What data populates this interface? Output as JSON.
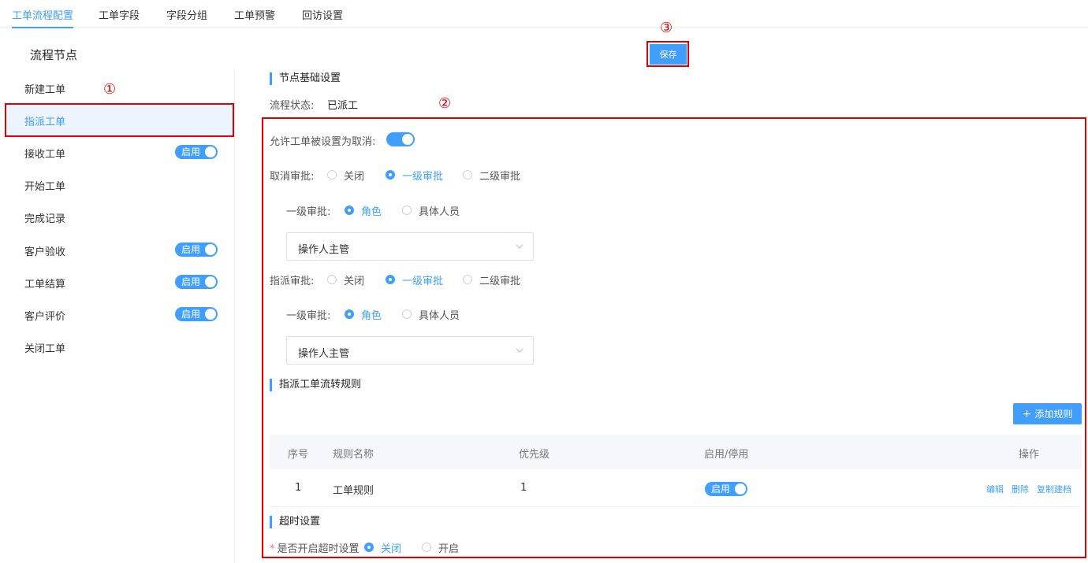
{
  "tabs": [
    {
      "label": "工单流程配置",
      "active": true
    },
    {
      "label": "工单字段",
      "active": false
    },
    {
      "label": "字段分组",
      "active": false
    },
    {
      "label": "工单预警",
      "active": false
    },
    {
      "label": "回访设置",
      "active": false
    }
  ],
  "sidebar": {
    "title": "流程节点",
    "items": [
      {
        "label": "新建工单",
        "toggle": null
      },
      {
        "label": "指派工单",
        "toggle": null
      },
      {
        "label": "接收工单",
        "toggle": "启用"
      },
      {
        "label": "开始工单",
        "toggle": null
      },
      {
        "label": "完成记录",
        "toggle": null
      },
      {
        "label": "客户验收",
        "toggle": "启用"
      },
      {
        "label": "工单结算",
        "toggle": "启用"
      },
      {
        "label": "客户评价",
        "toggle": "启用"
      },
      {
        "label": "关闭工单",
        "toggle": null
      }
    ]
  },
  "annotations": {
    "one": "①",
    "two": "②",
    "three": "③"
  },
  "toolbar": {
    "save_label": "保存"
  },
  "basic": {
    "title": "节点基础设置",
    "status_label": "流程状态:",
    "status_value": "已派工"
  },
  "cancel": {
    "allow_label": "允许工单被设置为取消:",
    "allow_on": true,
    "approval_label": "取消审批:",
    "options": [
      "关闭",
      "一级审批",
      "二级审批"
    ],
    "selected": 1,
    "level1_label": "一级审批:",
    "level1_options": [
      "角色",
      "具体人员"
    ],
    "level1_selected": 0,
    "select_value": "操作人主管"
  },
  "assign": {
    "approval_label": "指派审批:",
    "options": [
      "关闭",
      "一级审批",
      "二级审批"
    ],
    "selected": 1,
    "level1_label": "一级审批:",
    "level1_options": [
      "角色",
      "具体人员"
    ],
    "level1_selected": 0,
    "select_value": "操作人主管"
  },
  "rules": {
    "title": "指派工单流转规则",
    "add_label": "添加规则",
    "columns": [
      "序号",
      "规则名称",
      "优先级",
      "启用/停用",
      "操作"
    ],
    "rows": [
      {
        "index": "1",
        "name": "工单规则",
        "priority": "1",
        "toggle": "启用",
        "actions": [
          "编辑",
          "删除",
          "复制建档"
        ]
      }
    ]
  },
  "timeout": {
    "title": "超时设置",
    "required_mark": "*",
    "label": "是否开启超时设置",
    "options": [
      "关闭",
      "开启"
    ],
    "selected": 0
  },
  "colors": {
    "accent": "#409eff",
    "annotation": "#e00000"
  }
}
